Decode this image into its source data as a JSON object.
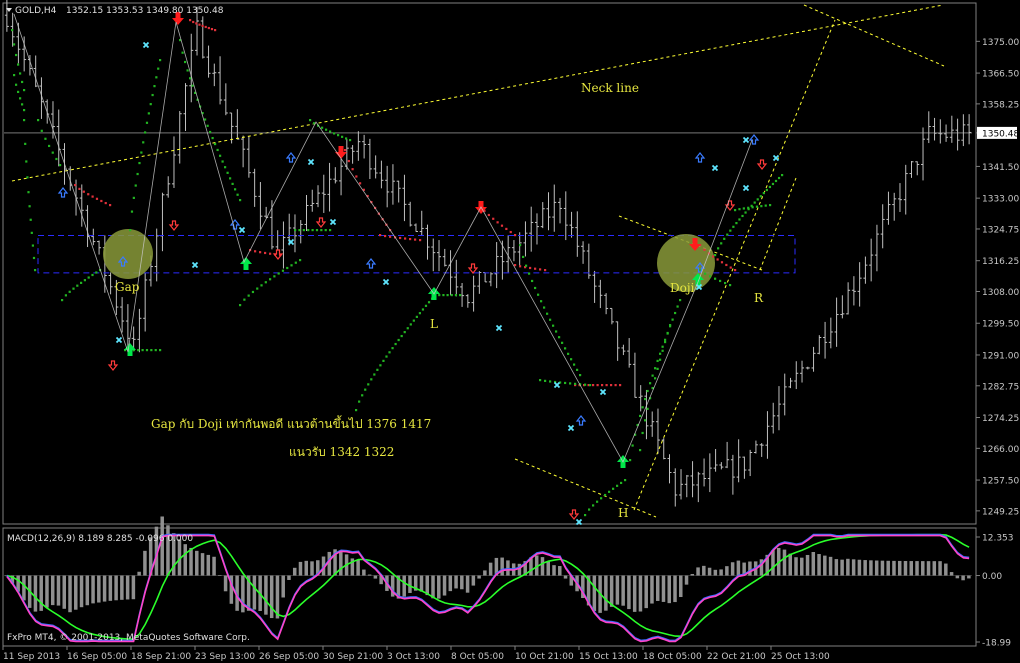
{
  "window": {
    "symbol_label": "GOLD,H4",
    "ohlc_label": "1352.15 1353.53 1349.80 1350.48",
    "indicator_label": "MACD(12,26,9) 8.189 8.285 -0.096 0.000",
    "copyright": "FxPro MT4, © 2001-2013, MetaQuotes Software Corp."
  },
  "colors": {
    "background": "#000000",
    "grid_frame": "#808080",
    "candles": "#c0c0c0",
    "sar_green": "#22b522",
    "sar_red": "#e0303a",
    "arrow_up_green": "#00e84a",
    "arrow_down_red": "#ff1c1c",
    "fractal_up": "#3a7bff",
    "fractal_down": "#ff3a3a",
    "cross": "#5fe6ff",
    "zigzag": "#c8c8c8",
    "annotation": "#ffff33",
    "channel": "#2b2bff",
    "highlight": "#8a9a3a",
    "macd_line": "#3c6cff",
    "macd_pink": "#ff44c8",
    "macd_signal": "#2aff2a",
    "histogram": "#909090",
    "current_price_line": "#c0c0c0"
  },
  "chart_data": [
    {
      "type": "candlestick",
      "title": "GOLD,H4",
      "timeframe": "H4",
      "ylim": [
        1246,
        1385
      ],
      "y_ticks": [
        "1375.00",
        "1366.50",
        "1358.25",
        "1350.48",
        "1341.50",
        "1333.00",
        "1324.75",
        "1316.25",
        "1308.00",
        "1299.50",
        "1291.00",
        "1282.75",
        "1274.25",
        "1266.00",
        "1257.50",
        "1249.25"
      ],
      "current_price": "1350.48",
      "x_ticks": [
        "11 Sep 2013",
        "16 Sep 05:00",
        "18 Sep 21:00",
        "23 Sep 13:00",
        "26 Sep 05:00",
        "30 Sep 21:00",
        "3 Oct 13:00",
        "8 Oct 05:00",
        "10 Oct 21:00",
        "15 Oct 13:00",
        "18 Oct 05:00",
        "22 Oct 21:00",
        "25 Oct 13:00"
      ],
      "zigzag_path": [
        [
          0,
          1382
        ],
        [
          22,
          1293
        ],
        [
          33,
          1378
        ],
        [
          47,
          1318
        ],
        [
          61,
          1348
        ],
        [
          80,
          1307
        ],
        [
          96,
          1332
        ],
        [
          116,
          1255
        ],
        [
          128,
          1262
        ],
        [
          147,
          1310
        ],
        [
          160,
          1350
        ]
      ],
      "annotations": {
        "neck_line": "Neck line",
        "gap": "Gap",
        "doji": "Doji",
        "left_shoulder": "L",
        "head": "H",
        "right_shoulder": "R",
        "comment_1": "Gap กับ Doji เท่ากันพอดี แนวต้านขึ้นไป 1376  1417",
        "comment_2": "แนวรับ  1342   1322"
      },
      "support_channel": [
        1313,
        1323
      ]
    },
    {
      "type": "macd",
      "title": "MACD(12,26,9)",
      "parameters": [
        12,
        26,
        9
      ],
      "values": {
        "macd": 8.189,
        "signal": 8.285,
        "histogram": -0.096,
        "level": 0.0
      },
      "ylim": [
        -18.99,
        12.353
      ],
      "y_ticks": [
        "12.353",
        "0.00",
        "-18.99"
      ]
    }
  ]
}
